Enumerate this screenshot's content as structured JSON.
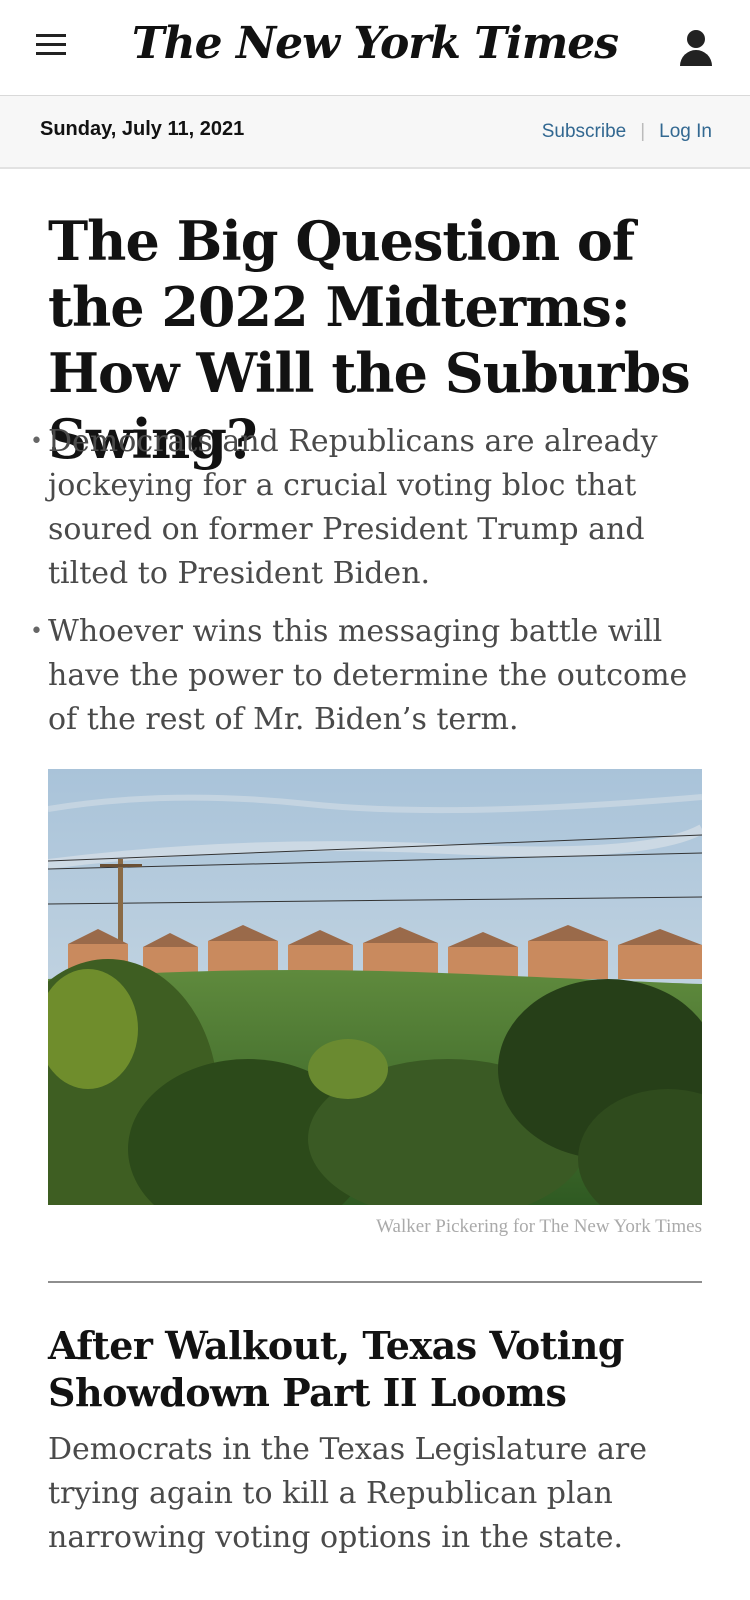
{
  "header": {
    "logo": "The New York Times",
    "menu_icon": "hamburger-menu-icon",
    "account_icon": "user-icon"
  },
  "datebar": {
    "date": "Sunday, July 11, 2021",
    "subscribe": "Subscribe",
    "separator": "|",
    "login": "Log In"
  },
  "lead": {
    "headline": "The Big Question of the 2022 Midterms: How Will the Suburbs Swing?",
    "bullets": [
      "Democrats and Republicans are already jockeying for a crucial voting bloc that soured on former President Trump and tilted to President Biden.",
      "Whoever wins this messaging battle will have the power to determine the outcome of the rest of Mr. Biden’s term."
    ],
    "photo_credit": "Walker Pickering for The New York Times"
  },
  "second": {
    "headline": "After Walkout, Texas Voting Showdown Part II Looms",
    "summary": "Democrats in the Texas Legislature are trying again to kill a Republican plan narrowing voting options in the state."
  },
  "colors": {
    "link": "#326891",
    "summary_text": "#4a4a4a",
    "datebar_bg": "#f7f7f7"
  }
}
